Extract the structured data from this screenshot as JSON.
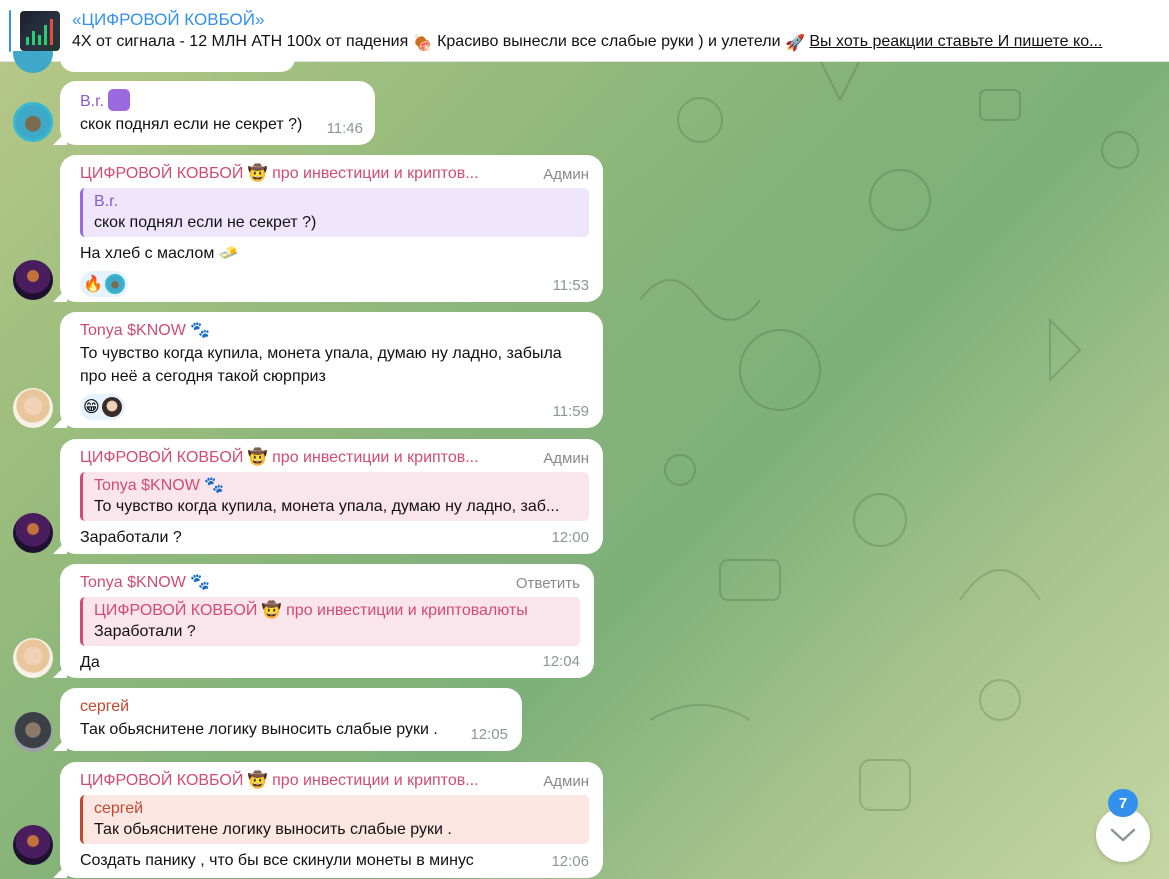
{
  "pinned": {
    "title": "«ЦИФРОВОЙ КОВБОЙ»",
    "text_part1": "4Х от сигнала - 12 МЛН АТН  100х от падения ",
    "text_part2": "  Красиво вынесли все слабые руки ) и улетели ",
    "text_part3": "Вы хоть реакции ставьте И пишете ко..."
  },
  "messages": [
    {
      "sender": "B.r.",
      "text": "скок поднял если не секрет ?)",
      "time": "11:46"
    },
    {
      "sender": "ЦИФРОВОЙ КОВБОЙ 🤠 про инвестиции и криптов...",
      "admin": "Админ",
      "reply_name": "B.r.",
      "reply_text": "скок поднял если не секрет ?)",
      "text": "На хлеб с маслом 🧈",
      "time": "11:53"
    },
    {
      "sender": "Tonya $KNOW 🐾",
      "text_line1": "То чувство когда купила, монета упала, думаю ну ладно, забыла",
      "text_line2": "про неё а сегодня такой сюрприз",
      "time": "11:59"
    },
    {
      "sender": "ЦИФРОВОЙ КОВБОЙ 🤠 про инвестиции и криптов...",
      "admin": "Админ",
      "reply_name": "Tonya $KNOW 🐾",
      "reply_text": "То чувство когда купила, монета упала, думаю ну ладно, заб...",
      "text": "Заработали ?",
      "time": "12:00"
    },
    {
      "sender": "Tonya $KNOW 🐾",
      "action": "Ответить",
      "reply_name": "ЦИФРОВОЙ КОВБОЙ 🤠 про инвестиции и криптовалюты",
      "reply_text": "Заработали ?",
      "text": "Да",
      "time": "12:04"
    },
    {
      "sender": "сергей",
      "text": "Так обьяснитене логику выносить слабые руки .",
      "time": "12:05"
    },
    {
      "sender": "ЦИФРОВОЙ КОВБОЙ 🤠 про инвестиции и криптов...",
      "admin": "Админ",
      "reply_name": "сергей",
      "reply_text": "Так обьяснитене логику выносить слабые руки .",
      "text": "Создать панику , что бы все скинули монеты в минус",
      "time": "12:06"
    }
  ],
  "reactions": {
    "r1": "🔥",
    "r2": "😁"
  },
  "unread_badge": "7",
  "icons": {
    "scroll": "chevron-down-icon",
    "pinned_thumb": "chart-thumbnail-icon",
    "badge_emoji": "cowboy-hat-face-icon"
  },
  "colors": {
    "accent": "#3390ec",
    "admin_name": "#d14b73",
    "br_name": "#8c5bd3",
    "sergey_name": "#c4472f"
  }
}
